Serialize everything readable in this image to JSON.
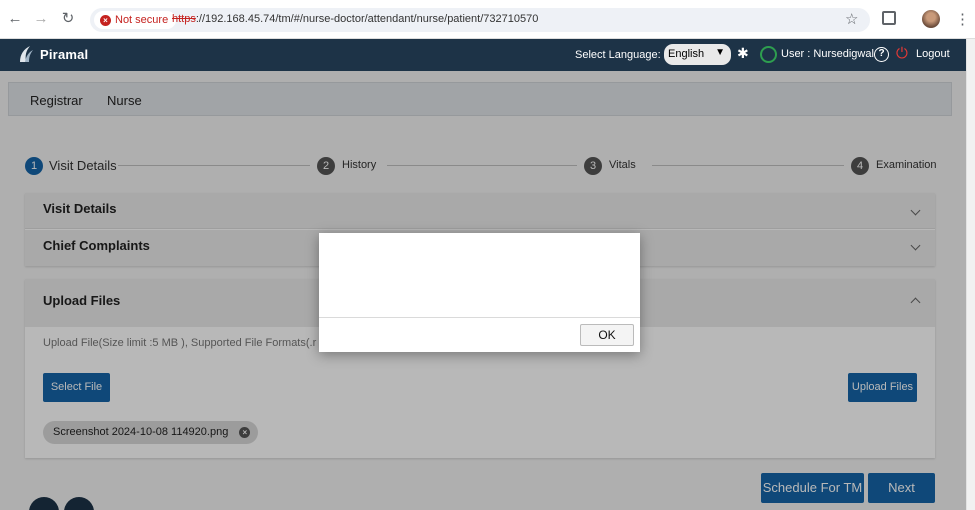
{
  "browser": {
    "security_label": "Not secure",
    "url_scheme": "https",
    "url_rest": "://192.168.45.74/tm/#/nurse-doctor/attendant/nurse/patient/732710570"
  },
  "header": {
    "brand": "Piramal",
    "language_label": "Select Language:",
    "language_value": "English",
    "user_label": "User : Nursedigwal",
    "logout_label": "Logout",
    "brand_color": "#1d3347"
  },
  "tabs": [
    {
      "label": "Registrar"
    },
    {
      "label": "Nurse"
    }
  ],
  "stepper": [
    {
      "number": "1",
      "label": "Visit Details",
      "active": true
    },
    {
      "number": "2",
      "label": "History",
      "active": false
    },
    {
      "number": "3",
      "label": "Vitals",
      "active": false
    },
    {
      "number": "4",
      "label": "Examination",
      "active": false
    }
  ],
  "panels": {
    "visit_details": "Visit Details",
    "chief_complaints": "Chief Complaints",
    "upload_files": "Upload Files"
  },
  "upload": {
    "note": "Upload File(Size limit :5 MB ), Supported File Formats(.r",
    "select_file": "Select File",
    "upload_files": "Upload Files",
    "file_chip": "Screenshot 2024-10-08 114920.png"
  },
  "actions": {
    "schedule_tm": "Schedule For TM",
    "next": "Next"
  },
  "dialog": {
    "ok_label": "OK"
  },
  "colors": {
    "primary": "#1565a8",
    "step_active": "#1565a8",
    "step_inactive": "#555555",
    "danger": "#e53935"
  }
}
